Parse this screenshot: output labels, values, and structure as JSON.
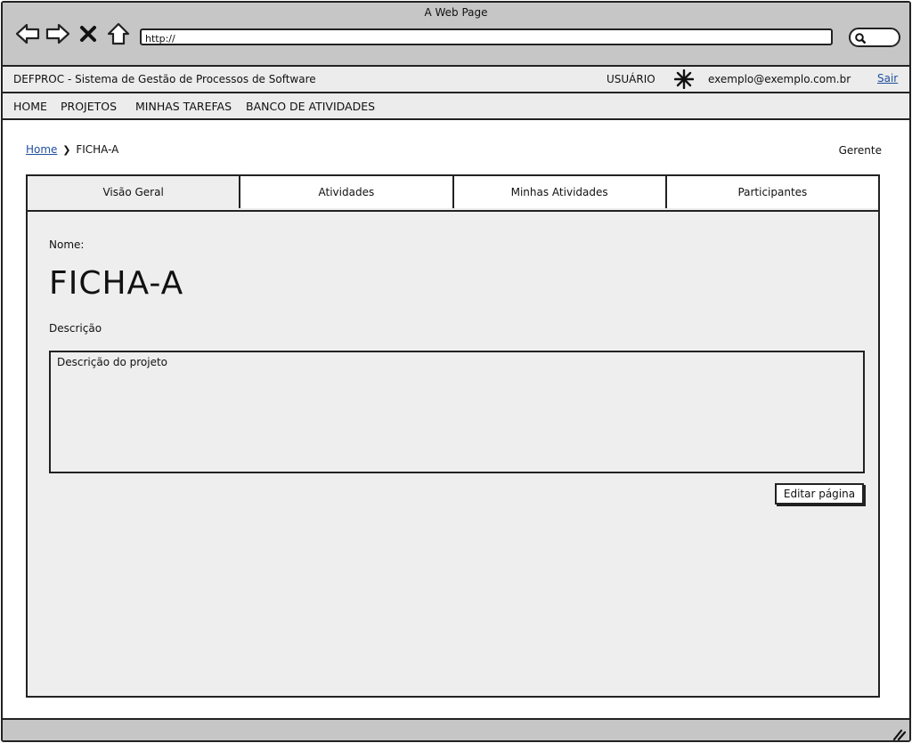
{
  "browser": {
    "title": "A Web Page",
    "address": "http://",
    "icons": [
      "back-arrow-icon",
      "forward-arrow-icon",
      "close-x-icon",
      "home-icon",
      "search-icon"
    ]
  },
  "appbar": {
    "system_name": "DEFPROC - Sistema de Gestão de Processos de Software",
    "user_label": "USUÁRIO",
    "email": "exemplo@exemplo.com.br",
    "logout": "Sair"
  },
  "menu": {
    "items": [
      "HOME",
      "PROJETOS",
      "MINHAS TAREFAS",
      "BANCO DE ATIVIDADES"
    ]
  },
  "breadcrumb": {
    "home": "Home",
    "current": "FICHA-A"
  },
  "role": "Gerente",
  "tabs": [
    {
      "label": "Visão Geral",
      "active": true
    },
    {
      "label": "Atividades",
      "active": false
    },
    {
      "label": "Minhas Atividades",
      "active": false
    },
    {
      "label": "Participantes",
      "active": false
    }
  ],
  "project": {
    "name_label": "Nome:",
    "name": "FICHA-A",
    "desc_label": "Descrição",
    "description": "Descrição do projeto",
    "edit_button": "Editar página"
  }
}
